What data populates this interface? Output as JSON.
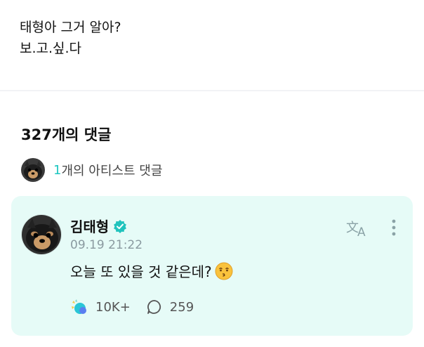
{
  "post": {
    "lines": [
      "태형아 그거 알아?",
      "보.고.싶.다"
    ]
  },
  "comments": {
    "count_label": "327개의 댓글",
    "artist_summary": {
      "count": "1",
      "label": "개의 아티스트 댓글"
    }
  },
  "featured_comment": {
    "author": "김태형",
    "timestamp": "09.19 21:22",
    "text": "오늘 또 있을 것 같은데?",
    "likes": "10K+",
    "replies": "259"
  },
  "colors": {
    "accent": "#1fc7c1",
    "card_bg": "#e6fbf7",
    "verified": "#20c3bd"
  },
  "icons": [
    "verified-badge-icon",
    "translate-icon",
    "more-vertical-icon",
    "like-reaction-icon",
    "reply-bubble-icon",
    "kissing-face-emoji"
  ]
}
